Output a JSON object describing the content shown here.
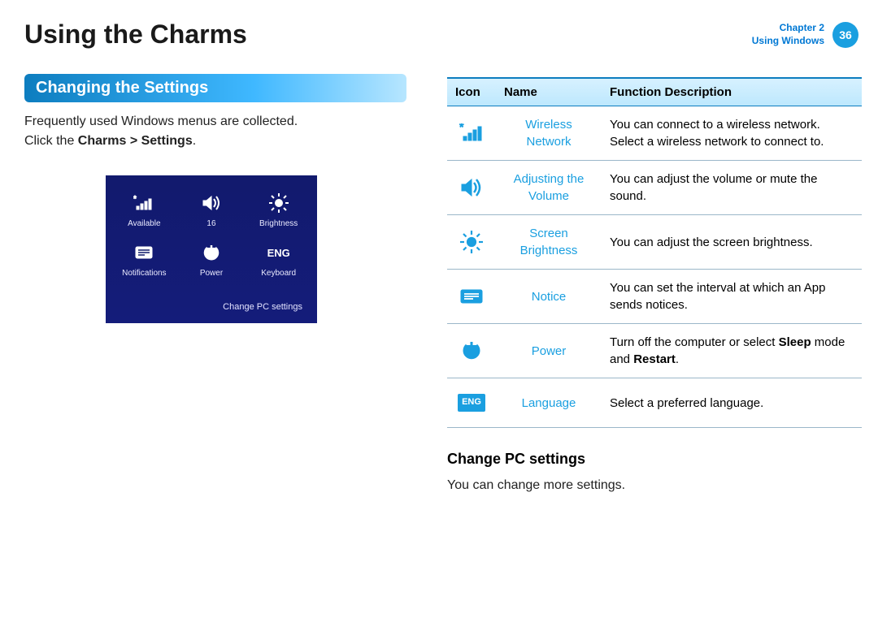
{
  "header": {
    "title": "Using the Charms",
    "chapter_label": "Chapter 2",
    "section_label": "Using Windows",
    "page_number": "36"
  },
  "section": {
    "heading": "Changing the Settings",
    "intro_line1": "Frequently used Windows menus are collected.",
    "intro_click_prefix": "Click the ",
    "intro_click_bold": "Charms > Settings",
    "intro_click_suffix": "."
  },
  "charms_panel": {
    "items": [
      {
        "label": "Available",
        "icon": "network"
      },
      {
        "label": "16",
        "icon": "volume"
      },
      {
        "label": "Brightness",
        "icon": "brightness"
      },
      {
        "label": "Notifications",
        "icon": "notifications"
      },
      {
        "label": "Power",
        "icon": "power"
      },
      {
        "label": "Keyboard",
        "icon": "keyboard",
        "text_icon": "ENG"
      }
    ],
    "footer": "Change PC settings"
  },
  "table": {
    "headers": {
      "icon": "Icon",
      "name": "Name",
      "desc": "Function Description"
    },
    "rows": [
      {
        "icon": "network",
        "name": "Wireless Network",
        "desc": "You can connect to a wireless network. Select a wireless network to connect to."
      },
      {
        "icon": "volume",
        "name": "Adjusting the Volume",
        "desc": "You can adjust the volume or mute the sound."
      },
      {
        "icon": "brightness",
        "name": "Screen Brightness",
        "desc": "You can adjust the screen brightness."
      },
      {
        "icon": "notifications",
        "name": "Notice",
        "desc": "You can set the interval at which an App sends notices."
      },
      {
        "icon": "power",
        "name": "Power",
        "desc_prefix": "Turn off the computer or select ",
        "desc_bold1": "Sleep",
        "desc_mid": " mode and ",
        "desc_bold2": "Restart",
        "desc_suffix": "."
      },
      {
        "icon": "language",
        "text_icon": "ENG",
        "name": "Language",
        "desc": "Select a preferred language."
      }
    ]
  },
  "subsection": {
    "heading": "Change PC settings",
    "body": "You can change more settings."
  }
}
